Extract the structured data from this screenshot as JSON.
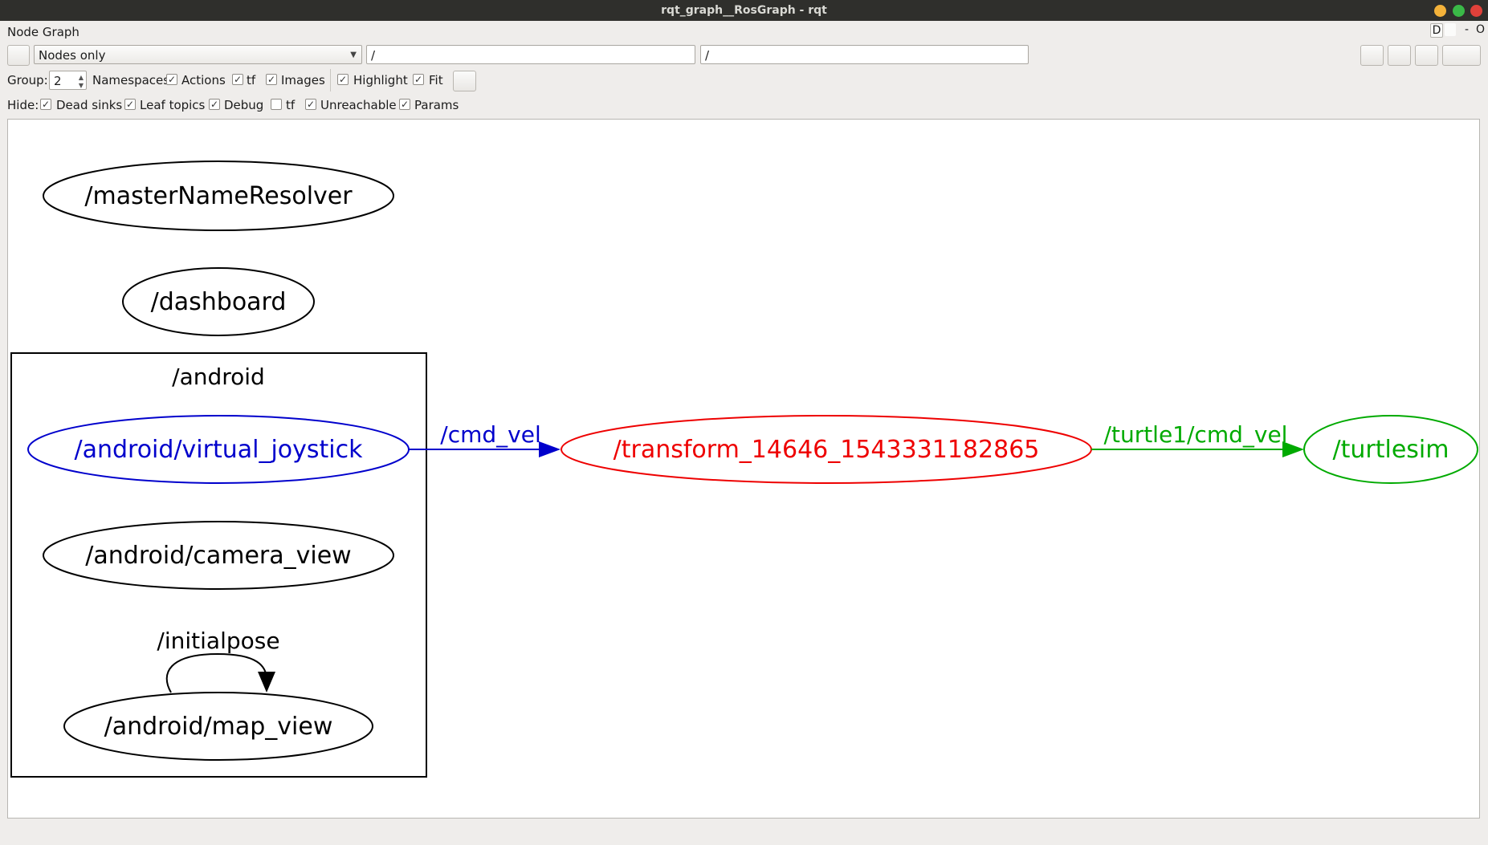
{
  "window": {
    "title": "rqt_graph__RosGraph - rqt"
  },
  "plugin": {
    "title": "Node Graph",
    "d_button": "D",
    "minus_button": "-",
    "close_button": "O"
  },
  "toolbar": {
    "mode_select": "Nodes only",
    "node_filter": "/",
    "topic_filter": "/"
  },
  "options": {
    "group_label": "Group:",
    "group_value": "2",
    "items": [
      {
        "label": "Namespaces",
        "checked": true
      },
      {
        "label": "Actions",
        "checked": true
      },
      {
        "label": "tf",
        "checked": true
      },
      {
        "label": "Images",
        "checked": true
      },
      {
        "label": "Highlight",
        "checked": true
      },
      {
        "label": "Fit",
        "checked": true
      }
    ]
  },
  "hide": {
    "label": "Hide:",
    "items": [
      {
        "label": "Dead sinks",
        "checked": true
      },
      {
        "label": "Leaf topics",
        "checked": true
      },
      {
        "label": "Debug",
        "checked": true
      },
      {
        "label": "tf",
        "checked": false
      },
      {
        "label": "Unreachable",
        "checked": true
      },
      {
        "label": "Params",
        "checked": true
      }
    ]
  },
  "graph": {
    "colors": {
      "black": "#000000",
      "blue": "#0000cc",
      "red": "#ee0000",
      "green": "#00aa00"
    },
    "cluster": {
      "label": "/android"
    },
    "nodes": {
      "master_name_resolver": "/masterNameResolver",
      "dashboard": "/dashboard",
      "virtual_joystick": "/android/virtual_joystick",
      "camera_view": "/android/camera_view",
      "map_view": "/android/map_view",
      "transform": "/transform_14646_1543331182865",
      "turtlesim": "/turtlesim"
    },
    "edges": {
      "cmd_vel": "/cmd_vel",
      "turtle_cmd_vel": "/turtle1/cmd_vel",
      "initialpose": "/initialpose"
    }
  }
}
